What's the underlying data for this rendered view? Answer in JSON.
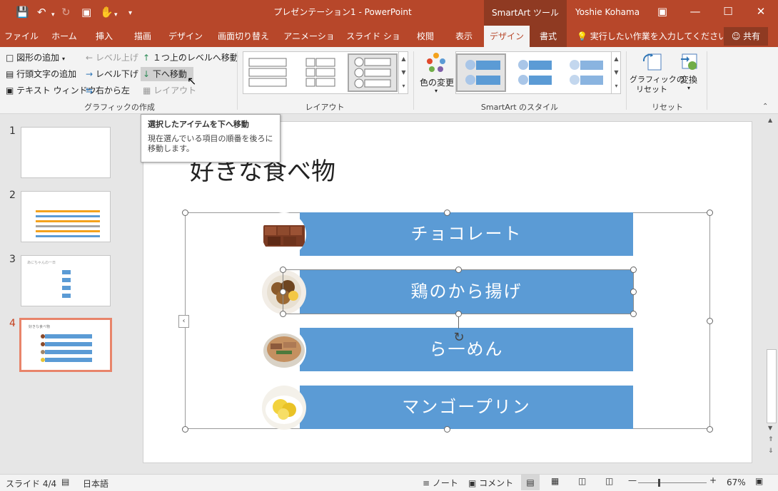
{
  "window": {
    "title": "プレゼンテーション1 - PowerPoint",
    "context_tools": "SmartArt ツール",
    "user": "Yoshie Kohama"
  },
  "tabs": [
    "ファイル",
    "ホーム",
    "挿入",
    "描画",
    "デザイン",
    "画面切り替え",
    "アニメーション",
    "スライド ショー",
    "校閲",
    "表示",
    "デザイン",
    "書式"
  ],
  "tell_me": "実行したい作業を入力してください",
  "share": "共有",
  "ribbon": {
    "create": {
      "add_shape": "図形の追加",
      "add_bullet": "行頭文字の追加",
      "text_pane": "テキスト ウィンドウ",
      "promote": "レベル上げ",
      "demote": "レベル下げ",
      "rtl": "右から左",
      "move_up": "１つ上のレベルへ移動",
      "move_down": "下へ移動",
      "layout": "レイアウト",
      "label": "グラフィックの作成"
    },
    "layouts_label": "レイアウト",
    "color_change": "色の変更",
    "styles_label": "SmartArt のスタイル",
    "reset_graphic": "グラフィックの\nリセット",
    "convert": "変換",
    "reset_label": "リセット"
  },
  "tooltip": {
    "title": "選択したアイテムを下へ移動",
    "body": "現在選んでいる項目の順番を後ろに移動します。"
  },
  "slides": {
    "numbers": [
      "1",
      "2",
      "3",
      "4"
    ],
    "active": 4,
    "thumb3_title": "あにちゃんの一日",
    "thumb4_title": "好きな食べ物"
  },
  "slide": {
    "title": "好きな食べ物",
    "items": [
      "チョコレート",
      "鶏のから揚げ",
      "ら一めん",
      "マンゴープリン"
    ]
  },
  "status": {
    "slide_info": "スライド 4/4",
    "language": "日本語",
    "notes": "ノート",
    "comments": "コメント",
    "zoom": "67%"
  },
  "colors": {
    "accent": "#b7472a",
    "smartart": "#5b9bd5"
  }
}
